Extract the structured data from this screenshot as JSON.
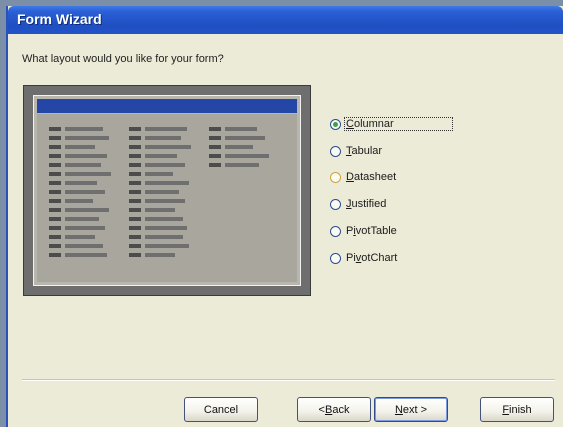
{
  "window": {
    "title": "Form Wizard"
  },
  "prompt": "What layout would you like for your form?",
  "options": [
    {
      "label": "Columnar",
      "accel": "C",
      "checked": true
    },
    {
      "label": "Tabular",
      "accel": "T",
      "checked": false
    },
    {
      "label": "Datasheet",
      "accel": "D",
      "checked": false
    },
    {
      "label": "Justified",
      "accel": "J",
      "checked": false
    },
    {
      "label": "PivotTable",
      "accel": "i",
      "checked": false
    },
    {
      "label": "PivotChart",
      "accel": "v",
      "checked": false
    }
  ],
  "buttons": {
    "cancel": "Cancel",
    "back": "< Back",
    "next": "Next >",
    "finish": "Finish"
  },
  "colors": {
    "titlebar": "#2a5fd6",
    "dialog_bg": "#ecebd8",
    "preview_header": "#2446a6",
    "radio_checked": "#3ea04a"
  }
}
